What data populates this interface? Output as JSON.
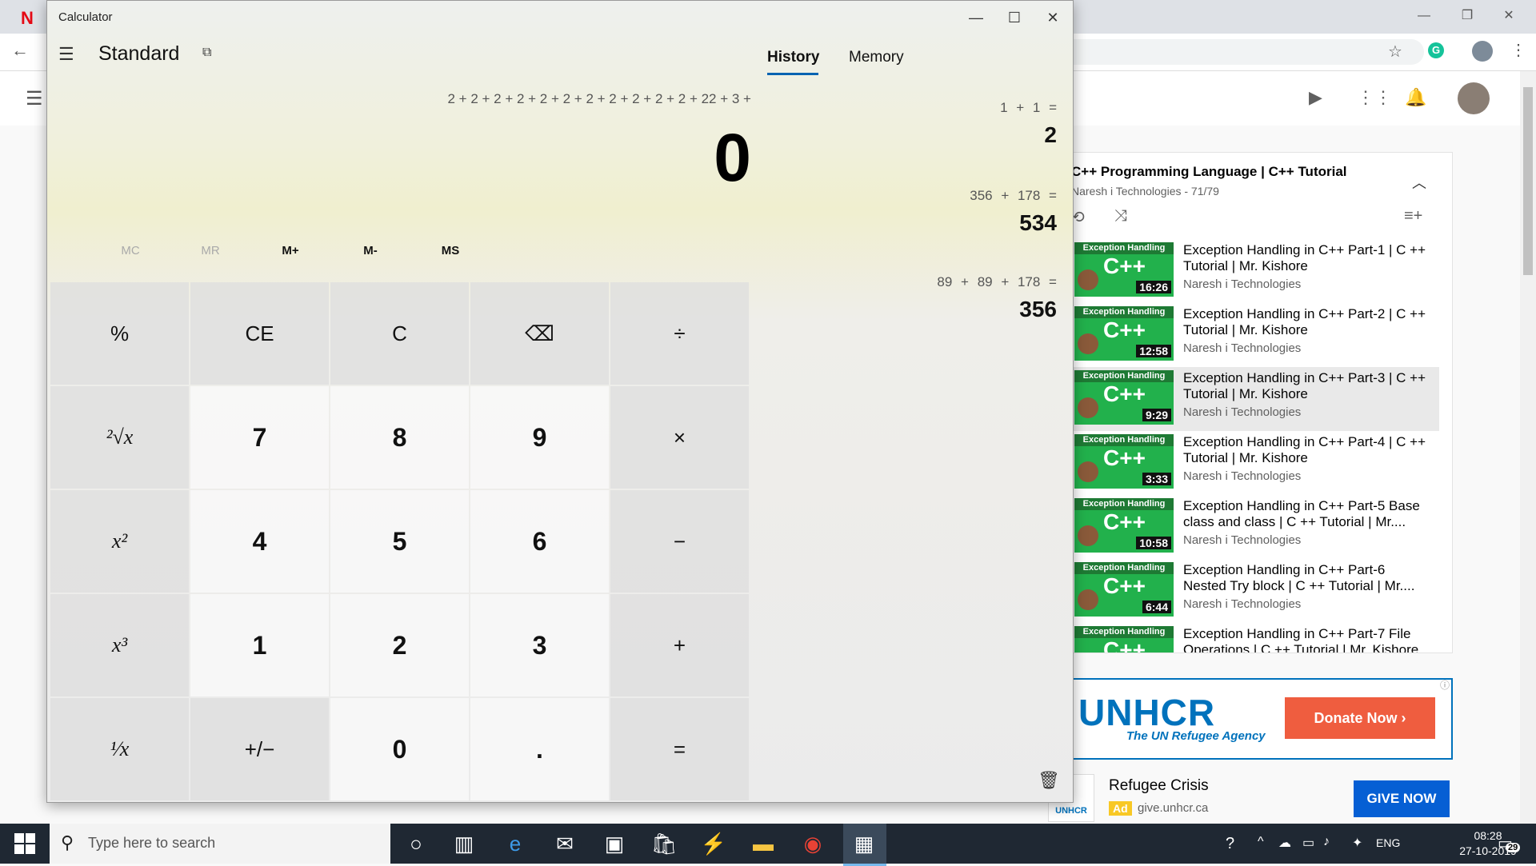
{
  "browser": {
    "netflix_logo": "N",
    "back_icon": "arrow-left-icon",
    "star_icon": "star-icon",
    "grammarly_icon": "G"
  },
  "youtube": {
    "playlist": {
      "title": "C++ Programming Language | C++ Tutorial",
      "subtitle": "Naresh i Technologies - 71/79",
      "items": [
        {
          "title": "Exception Handling in C++ Part-1 | C ++ Tutorial | Mr. Kishore",
          "channel": "Naresh i Technologies",
          "duration": "16:26",
          "thumb_label": "Exception Handling",
          "thumb_big": "C++"
        },
        {
          "title": "Exception Handling in C++ Part-2 | C ++ Tutorial | Mr. Kishore",
          "channel": "Naresh i Technologies",
          "duration": "12:58",
          "thumb_label": "Exception Handling",
          "thumb_big": "C++"
        },
        {
          "title": "Exception Handling in C++ Part-3 | C ++ Tutorial | Mr. Kishore",
          "channel": "Naresh i Technologies",
          "duration": "9:29",
          "thumb_label": "Exception Handling",
          "thumb_big": "C++"
        },
        {
          "title": "Exception Handling in C++ Part-4 | C ++ Tutorial | Mr. Kishore",
          "channel": "Naresh i Technologies",
          "duration": "3:33",
          "thumb_label": "Exception Handling",
          "thumb_big": "C++"
        },
        {
          "title": "Exception Handling in C++ Part-5 Base class and class | C ++ Tutorial | Mr....",
          "channel": "Naresh i Technologies",
          "duration": "10:58",
          "thumb_label": "Exception Handling",
          "thumb_big": "C++"
        },
        {
          "title": "Exception Handling in C++ Part-6 Nested Try block | C ++ Tutorial | Mr....",
          "channel": "Naresh i Technologies",
          "duration": "6:44",
          "thumb_label": "Exception Handling",
          "thumb_big": "C++"
        },
        {
          "title": "Exception Handling in C++ Part-7 File Operations | C ++ Tutorial | Mr. Kishore",
          "channel": "Naresh i Technologies",
          "duration": "",
          "thumb_label": "Exception Handling",
          "thumb_big": "C++"
        }
      ]
    },
    "ad_banner": {
      "logo": "UNHCR",
      "tagline": "The UN Refugee Agency",
      "button": "Donate Now ›"
    },
    "ad_text": {
      "logo": "UNHCR",
      "title": "Refugee Crisis",
      "badge": "Ad",
      "url": "give.unhcr.ca",
      "button": "GIVE NOW"
    }
  },
  "calculator": {
    "window_title": "Calculator",
    "mode": "Standard",
    "expression": "2 + 2 + 2 + 2 + 2 + 2 + 2 + 2 + 2 + 2 + 2 + 22 + 3 +",
    "display": "0",
    "memory_buttons": [
      "MC",
      "MR",
      "M+",
      "M-",
      "MS"
    ],
    "keys": [
      "%",
      "CE",
      "C",
      "⌫",
      "÷",
      "²√x",
      "7",
      "8",
      "9",
      "×",
      "x²",
      "4",
      "5",
      "6",
      "−",
      "x³",
      "1",
      "2",
      "3",
      "+",
      "¹⁄x",
      "+/−",
      "0",
      ".",
      "="
    ],
    "tabs": {
      "history": "History",
      "memory": "Memory"
    },
    "history": [
      {
        "expr": "1 + 1 =",
        "result": "2"
      },
      {
        "expr": "356 + 178 =",
        "result": "534"
      },
      {
        "expr": "89 + 89 + 178 =",
        "result": "356"
      }
    ]
  },
  "taskbar": {
    "search_placeholder": "Type here to search",
    "language": "ENG",
    "time": "08:28",
    "date": "27-10-2019",
    "notification_count": "29"
  }
}
